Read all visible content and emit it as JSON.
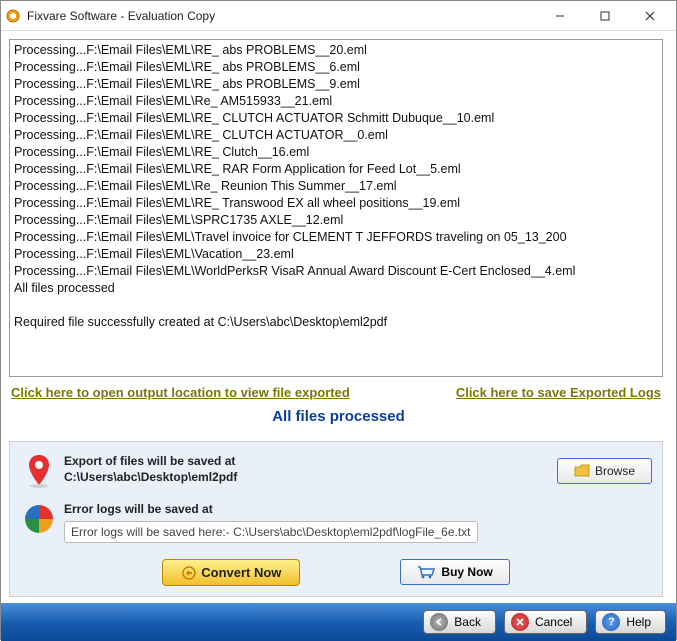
{
  "window": {
    "title": "Fixvare Software - Evaluation Copy"
  },
  "log_lines": [
    "Processing...F:\\Email Files\\EML\\RE_ abs PROBLEMS__20.eml",
    "Processing...F:\\Email Files\\EML\\RE_ abs PROBLEMS__6.eml",
    "Processing...F:\\Email Files\\EML\\RE_ abs PROBLEMS__9.eml",
    "Processing...F:\\Email Files\\EML\\Re_ AM515933__21.eml",
    "Processing...F:\\Email Files\\EML\\RE_ CLUTCH ACTUATOR Schmitt Dubuque__10.eml",
    "Processing...F:\\Email Files\\EML\\RE_ CLUTCH ACTUATOR__0.eml",
    "Processing...F:\\Email Files\\EML\\RE_ Clutch__16.eml",
    "Processing...F:\\Email Files\\EML\\RE_ RAR Form Application for Feed Lot__5.eml",
    "Processing...F:\\Email Files\\EML\\Re_ Reunion This Summer__17.eml",
    "Processing...F:\\Email Files\\EML\\RE_ Transwood EX all wheel positions__19.eml",
    "Processing...F:\\Email Files\\EML\\SPRC1735 AXLE__12.eml",
    "Processing...F:\\Email Files\\EML\\Travel invoice for CLEMENT T JEFFORDS traveling on 05_13_200",
    "Processing...F:\\Email Files\\EML\\Vacation__23.eml",
    "Processing...F:\\Email Files\\EML\\WorldPerksR VisaR Annual Award Discount E-Cert Enclosed__4.eml",
    "All files processed",
    "",
    "Required file successfully created at C:\\Users\\abc\\Desktop\\eml2pdf"
  ],
  "links": {
    "open_output": "Click here to open output location to view file exported",
    "save_logs": "Click here to save Exported Logs"
  },
  "status": "All files processed",
  "export": {
    "label": "Export of files will be saved at",
    "path": "C:\\Users\\abc\\Desktop\\eml2pdf",
    "browse": "Browse"
  },
  "errorlog": {
    "label": "Error logs will be saved at",
    "path": "Error logs will be saved here:- C:\\Users\\abc\\Desktop\\eml2pdf\\logFile_6e.txt"
  },
  "buttons": {
    "convert": "Convert Now",
    "buy": "Buy Now",
    "back": "Back",
    "cancel": "Cancel",
    "help": "Help"
  }
}
